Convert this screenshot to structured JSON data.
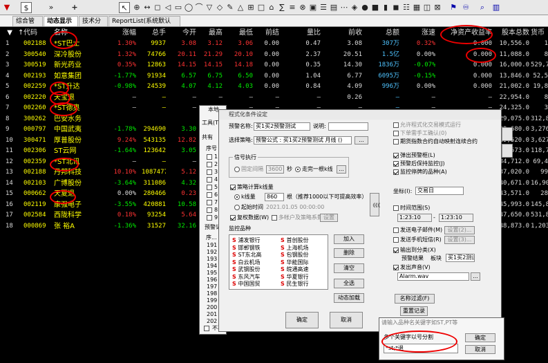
{
  "toolbar": {
    "dollar": "$",
    "arrows": "»",
    "plus": "+",
    "glyphs": [
      "⊕",
      "↔",
      "◻",
      "◁",
      "▭",
      "◯",
      "⌒",
      "▽",
      "◇",
      "✎",
      "△",
      "⊞",
      "□",
      "⌂",
      "∑",
      "≡",
      "⊗",
      "▣",
      "☰",
      "▤",
      "⋯",
      "◈",
      "●",
      "■",
      "▮",
      "◼",
      "☷",
      "▦",
      "◫",
      "⊠"
    ]
  },
  "tabs": [
    "综合管理",
    "动态显示牌",
    "技术分析",
    "ReportList(系统默认表):表"
  ],
  "headers": [
    "代码",
    "名称",
    "涨幅",
    "总手",
    "今开",
    "最高",
    "最低",
    "前结",
    "量比",
    "前收",
    "总额",
    "涨速",
    "净资产收益率",
    "股本总数",
    "货币"
  ],
  "rows": [
    {
      "n": "1",
      "code": "002188",
      "name": "*ST巴士",
      "chg": "1.30%",
      "vol": "9937",
      "open": "3.08",
      "high": "3.12",
      "low": "3.06",
      "pset": "0.00",
      "vr": "0.47",
      "prev": "3.08",
      "amt": "307万",
      "spd": "0.32%",
      "roe": "0.000",
      "shares": "10,556.0",
      "cur": "1"
    },
    {
      "n": "2",
      "code": "300540",
      "name": "深冷股份",
      "chg": "1.32%",
      "vol": "74766",
      "open": "20.11",
      "high": "21.29",
      "low": "20.10",
      "pset": "0.00",
      "vr": "2.37",
      "prev": "20.51",
      "amt": "1.5亿",
      "spd": "0.00%",
      "roe": "0.000",
      "shares": "11,088.0",
      "cur": "8"
    },
    {
      "n": "3",
      "code": "300519",
      "name": "新光药业",
      "chg": "0.35%",
      "vol": "12863",
      "open": "14.15",
      "high": "14.15",
      "low": "14.18",
      "pset": "0.00",
      "vr": "0.35",
      "prev": "14.30",
      "amt": "1836万",
      "spd": "-0.07%",
      "roe": "0.000",
      "shares": "16,000.0",
      "cur": "529,7"
    },
    {
      "n": "4",
      "code": "002193",
      "name": "如意集团",
      "chg": "-1.77%",
      "vol": "91934",
      "open": "6.57",
      "high": "6.75",
      "low": "6.50",
      "pset": "0.00",
      "vr": "1.04",
      "prev": "6.77",
      "amt": "6095万",
      "spd": "-0.15%",
      "roe": "0.000",
      "shares": "13,846.0",
      "cur": "52,5"
    },
    {
      "n": "5",
      "code": "002259",
      "name": "*ST升达",
      "chg": "-0.98%",
      "vol": "24539",
      "open": "4.07",
      "high": "4.12",
      "low": "4.03",
      "pset": "0.00",
      "vr": "0.84",
      "prev": "4.09",
      "amt": "996万",
      "spd": "0.00%",
      "roe": "0.000",
      "shares": "21,002.0",
      "cur": "19,8"
    },
    {
      "n": "6",
      "code": "002220",
      "name": "天宝退",
      "chg": "—",
      "vol": "—",
      "open": "—",
      "high": "—",
      "low": "—",
      "pset": "—",
      "vr": "—",
      "prev": "0.26",
      "amt": "—",
      "spd": "—",
      "roe": "—",
      "shares": "22,954.0",
      "cur": "8"
    },
    {
      "n": "7",
      "code": "002260",
      "name": "*ST德奥",
      "chg": "—",
      "vol": "—",
      "open": "—",
      "high": "—",
      "low": "—",
      "pset": "—",
      "vr": "—",
      "prev": "—",
      "amt": "—",
      "spd": "—",
      "roe": "—",
      "shares": "24,325.0",
      "cur": "3"
    },
    {
      "n": "8",
      "code": "300262",
      "name": "巴安水务",
      "chg": "",
      "vol": "",
      "open": "",
      "high": "",
      "low": "",
      "pset": "",
      "vr": "",
      "prev": "",
      "amt": "",
      "spd": "",
      "roe": "",
      "shares": "29,075.0",
      "cur": "312,8"
    },
    {
      "n": "9",
      "code": "000797",
      "name": "中国武夷",
      "chg": "-1.78%",
      "vol": "294690",
      "open": "3.30",
      "high": "",
      "low": "",
      "pset": "",
      "vr": "",
      "prev": "",
      "amt": "",
      "spd": "",
      "roe": "",
      "shares": "29,680.0",
      "cur": "3,276"
    },
    {
      "n": "10",
      "code": "300471",
      "name": "厚普股份",
      "chg": "9.24%",
      "vol": "543135",
      "open": "12.82",
      "high": "",
      "low": "",
      "pset": "",
      "vr": "",
      "prev": "",
      "amt": "",
      "spd": "",
      "roe": "",
      "shares": "29,520.0",
      "cur": "3,627"
    },
    {
      "n": "11",
      "code": "002306",
      "name": "ST云网",
      "chg": "-1.64%",
      "vol": "123642",
      "open": "3.05",
      "high": "",
      "low": "",
      "pset": "",
      "vr": "",
      "prev": "",
      "amt": "",
      "spd": "",
      "roe": "",
      "shares": "31,573.0",
      "cur": "118,7"
    },
    {
      "n": "12",
      "code": "002359",
      "name": "*ST北讯",
      "chg": "—",
      "vol": "—",
      "open": "—",
      "high": "",
      "low": "",
      "pset": "",
      "vr": "",
      "prev": "",
      "amt": "",
      "spd": "",
      "roe": "",
      "shares": "34,712.0",
      "cur": "69,4"
    },
    {
      "n": "13",
      "code": "002188",
      "name": "丹邦科技",
      "chg": "10.10%",
      "vol": "1087477",
      "open": "5.12",
      "high": "",
      "low": "",
      "pset": "",
      "vr": "",
      "prev": "",
      "amt": "",
      "spd": "",
      "roe": "",
      "shares": "37,020.0",
      "cur": "99"
    },
    {
      "n": "14",
      "code": "002103",
      "name": "广博股份",
      "chg": "-3.64%",
      "vol": "311086",
      "open": "4.32",
      "high": "",
      "low": "",
      "pset": "",
      "vr": "",
      "prev": "",
      "amt": "",
      "spd": "",
      "roe": "",
      "shares": "40,671.0",
      "cur": "16,90"
    },
    {
      "n": "15",
      "code": "000662",
      "name": "天夏退",
      "chg": "0.00%",
      "vol": "280466",
      "open": "0.23",
      "high": "",
      "low": "",
      "pset": "",
      "vr": "",
      "prev": "",
      "amt": "",
      "spd": "",
      "roe": "",
      "shares": "43,571.0",
      "cur": "28"
    },
    {
      "n": "16",
      "code": "002119",
      "name": "康强电子",
      "chg": "-3.55%",
      "vol": "420881",
      "open": "10.58",
      "high": "",
      "low": "",
      "pset": "",
      "vr": "",
      "prev": "",
      "amt": "",
      "spd": "",
      "roe": "",
      "shares": "45,993.0",
      "cur": "145,8"
    },
    {
      "n": "17",
      "code": "002584",
      "name": "西陇科学",
      "chg": "0.18%",
      "vol": "93254",
      "open": "5.64",
      "high": "",
      "low": "",
      "pset": "",
      "vr": "",
      "prev": "",
      "amt": "",
      "spd": "",
      "roe": "",
      "shares": "47,650.0",
      "cur": "531,8"
    },
    {
      "n": "18",
      "code": "000869",
      "name": "张 裕A",
      "chg": "-1.36%",
      "vol": "31527",
      "open": "32.16",
      "high": "",
      "low": "",
      "pset": "",
      "vr": "",
      "prev": "",
      "amt": "",
      "spd": "",
      "roe": "",
      "shares": "48,873.0",
      "cur": "1,203"
    }
  ],
  "bgwin": {
    "title": "本地",
    "tool": "工具(T)",
    "total": "共有",
    "seq": "序号",
    "seqnums": [
      "1",
      "2",
      "3",
      "4",
      "5",
      "6",
      "7",
      "8",
      "9"
    ],
    "warnlbl": "预警记",
    "seqlbl": "序...",
    "nums": [
      "191",
      "192",
      "193",
      "194",
      "195",
      "196",
      "197",
      "198",
      "199",
      "200",
      "201",
      "202"
    ],
    "nodisp": "不再"
  },
  "dlg": {
    "title": "程式化条件设定",
    "alarm_name_lbl": "预警名称:",
    "alarm_name": "买1买2预警测试",
    "desc_lbl": "说明:",
    "strategy_lbl": "选择策略:",
    "strategy": "预警公式 : 买1买2预警测试 月线 ()",
    "strategy_btn": "...",
    "signal_lbl": "信号执行",
    "fixed_lbl": "固定间隔",
    "fixed_val": "3600",
    "sec": "秒",
    "complete_lbl": "走完一根k线",
    "calc_lbl": "策略计算k线量",
    "kline_lbl": "k线量",
    "kline_val": "860",
    "kline_note": "根（推荐1000以下可提高效率）",
    "start_lbl": "起始时间",
    "start_val": "2021.01.05 00:00:00",
    "reset_lbl": "复权数据(W)",
    "multi_lbl": "多帐户及策略系数",
    "settings_btn": "设置",
    "pool_lbl": "监控品种",
    "pool_left": [
      "浦发银行",
      "邯郸钢铁",
      "ST东北高",
      "白云机场",
      "武钢股份",
      "东风汽车",
      "中国国贸"
    ],
    "pool_right": [
      "首创股份",
      "上海机场",
      "包钢股份",
      "华能国际",
      "皖通高速",
      "华夏银行",
      "民生银行"
    ],
    "add_btn": "加入",
    "del_btn": "删除",
    "clear_btn": "清空",
    "all_btn": "全选",
    "dynamic_btn": "动态加载",
    "ok_btn": "确定",
    "cancel_btn": "取消",
    "collapse_btn": "《《《",
    "opt1": "允许程式化交易模式运行",
    "opt2": "下单需手工确认(0)",
    "opt3": "期货指数合约自动映射连续合约",
    "popup_lbl": "弹出预警框(L)",
    "keep_lbl": "预警后保持监控(J)",
    "monitor_lbl": "监控停牌的品种(A)",
    "coord_lbl": "坐标(I):",
    "coord_val": "交易日",
    "time_lbl": "时间范围(S)",
    "time_from": "1:23:10",
    "time_to": "1:23:10",
    "email_lbl": "发送电子邮件(M)",
    "email_btn": "设置(2)...",
    "sms_lbl": "发送手机短信(R)",
    "sms_btn": "设置(3)...",
    "output_lbl": "输出到分类(X)",
    "alert_result": "预警结果",
    "board_lbl": "板块",
    "board_val": "买1买2测试",
    "sound_lbl": "发出声音(V)",
    "sound_val": "Alarm.wav",
    "sound_btn": "...",
    "filter_btn": "名称过滤(F)",
    "reset_btn": "重置记录",
    "side_btns": [
      "",
      ""
    ]
  },
  "kw": {
    "title": "请输入品种名关键字如ST,PT等",
    "lbl": "多个关键字以号分割",
    "val": "*st;*退",
    "ok": "确定",
    "cancel": "取消"
  }
}
